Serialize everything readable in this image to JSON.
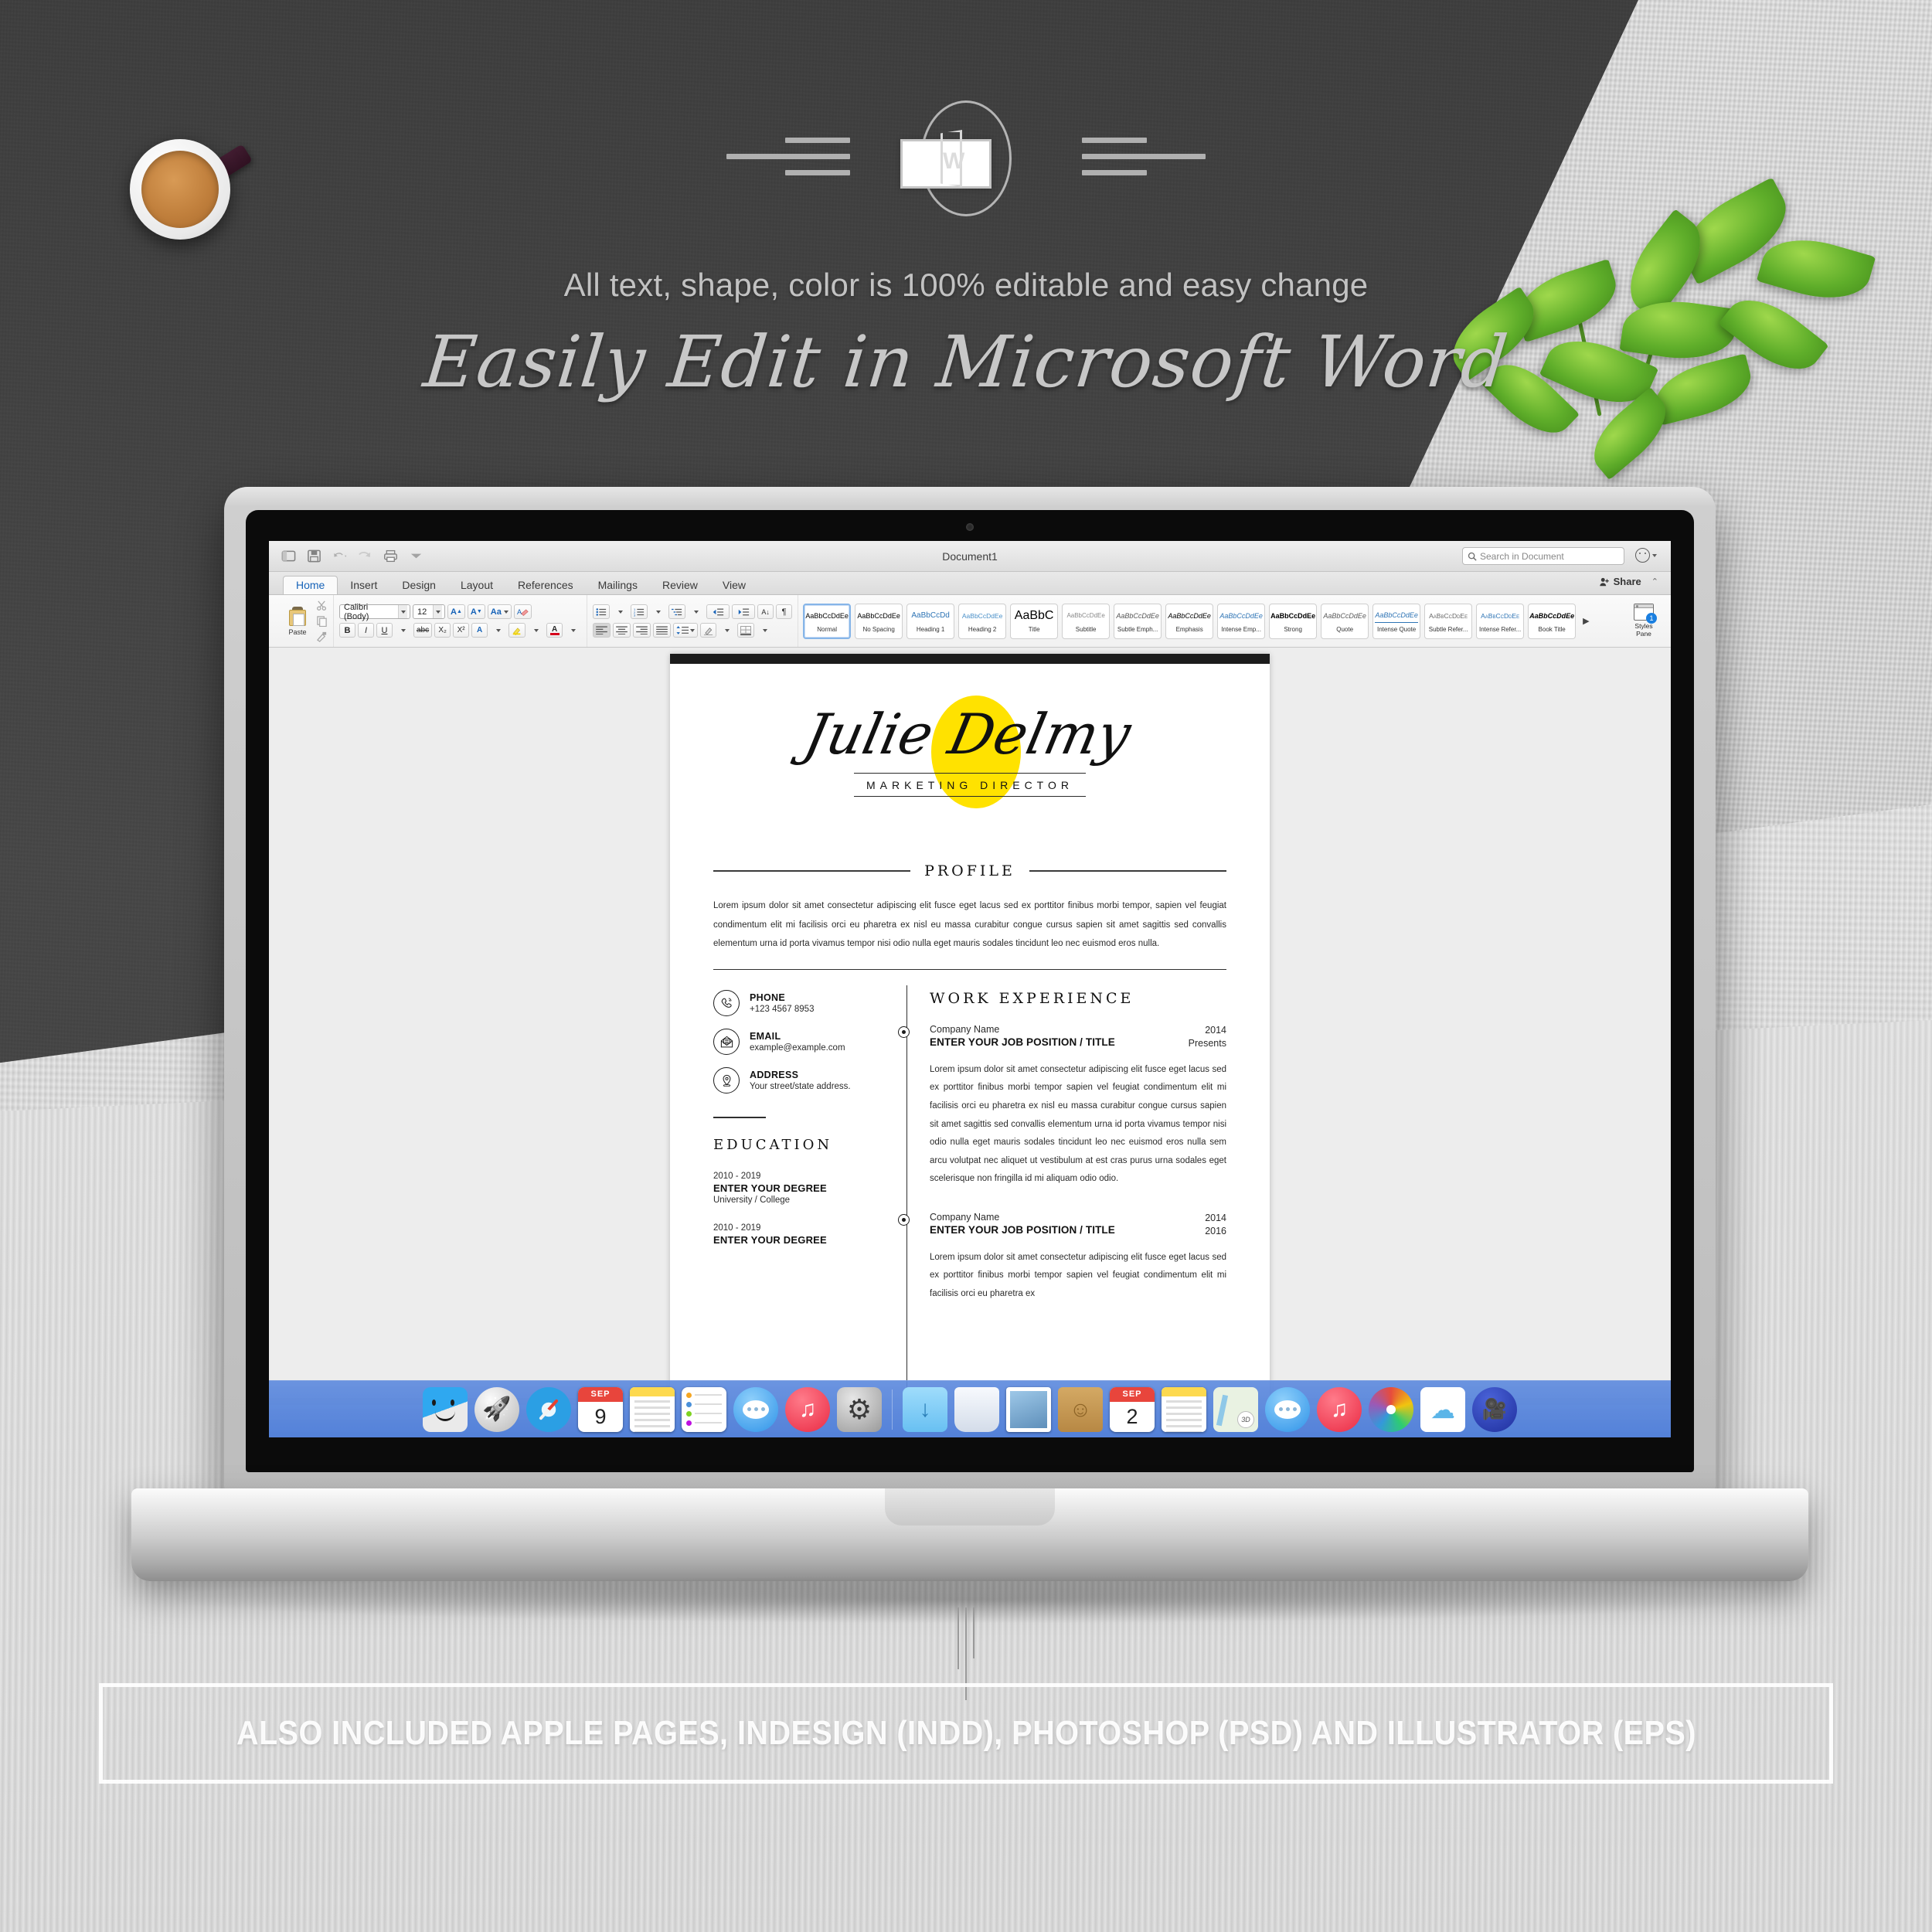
{
  "promo": {
    "word_icon_letter": "W",
    "subheadline": "All text, shape, color is 100% editable and easy change",
    "headline": "Easily Edit in Microsoft Word",
    "bottom_banner": "ALSO INCLUDED APPLE PAGES, INDESIGN (INDD), PHOTOSHOP (PSD) AND ILLUSTRATOR (EPS)"
  },
  "word": {
    "title": "Document1",
    "search_placeholder": "Search in Document",
    "share_label": "Share",
    "share_chevron": "⌃",
    "tabs": [
      {
        "label": "Home",
        "active": true
      },
      {
        "label": "Insert",
        "active": false
      },
      {
        "label": "Design",
        "active": false
      },
      {
        "label": "Layout",
        "active": false
      },
      {
        "label": "References",
        "active": false
      },
      {
        "label": "Mailings",
        "active": false
      },
      {
        "label": "Review",
        "active": false
      },
      {
        "label": "View",
        "active": false
      }
    ],
    "quick_access": [
      "sidebar-toggle-icon",
      "save-icon",
      "undo-icon",
      "redo-icon",
      "print-icon",
      "customize-qat-icon"
    ],
    "clipboard": {
      "paste_label": "Paste",
      "cut_icon": "scissors-icon",
      "copy_icon": "copy-icon",
      "format_painter_icon": "paintbrush-icon"
    },
    "font": {
      "family_value": "Calibri (Body)",
      "size_value": "12",
      "grow_label": "A",
      "shrink_label": "A",
      "change_case_label": "Aa",
      "clear_format_label": "A",
      "bold_label": "B",
      "italic_label": "I",
      "underline_label": "U",
      "strikethrough_label": "abc",
      "subscript_label": "X₂",
      "superscript_label": "X²",
      "text_effects_label": "A",
      "highlight_label": "A",
      "font_color_label": "A"
    },
    "paragraph": {
      "bullets_icon": "bulleted-list-icon",
      "numbering_icon": "numbered-list-icon",
      "multilevel_icon": "multilevel-list-icon",
      "decrease_indent_icon": "decrease-indent-icon",
      "increase_indent_icon": "increase-indent-icon",
      "sort_label": "A↓",
      "marks_label": "¶",
      "align_left_icon": "align-left-icon",
      "align_center_icon": "align-center-icon",
      "align_right_icon": "align-right-icon",
      "justify_icon": "justify-icon",
      "line_spacing_icon": "line-spacing-icon",
      "shading_icon": "shading-icon",
      "borders_icon": "borders-icon"
    },
    "styles": [
      {
        "preview": "AaBbCcDdEe",
        "name": "Normal",
        "selected": true
      },
      {
        "preview": "AaBbCcDdEe",
        "name": "No Spacing",
        "selected": false
      },
      {
        "preview": "AaBbCcDd",
        "name": "Heading 1",
        "selected": false
      },
      {
        "preview": "AaBbCcDdEe",
        "name": "Heading 2",
        "selected": false
      },
      {
        "preview": "AaBbC",
        "name": "Title",
        "selected": false
      },
      {
        "preview": "AaBbCcDdEe",
        "name": "Subtitle",
        "selected": false
      },
      {
        "preview": "AaBbCcDdEe",
        "name": "Subtle Emph...",
        "selected": false
      },
      {
        "preview": "AaBbCcDdEe",
        "name": "Emphasis",
        "selected": false
      },
      {
        "preview": "AaBbCcDdEe",
        "name": "Intense Emp...",
        "selected": false
      },
      {
        "preview": "AaBbCcDdEe",
        "name": "Strong",
        "selected": false
      },
      {
        "preview": "AaBbCcDdEe",
        "name": "Quote",
        "selected": false
      },
      {
        "preview": "AaBbCcDdEe",
        "name": "Intense Quote",
        "selected": false
      },
      {
        "preview": "AaBbCcDdEe",
        "name": "Subtle Refer...",
        "selected": false
      },
      {
        "preview": "AaBbCcDdEe",
        "name": "Intense Refer...",
        "selected": false
      },
      {
        "preview": "AaBbCcDdEe",
        "name": "Book Title",
        "selected": false
      }
    ],
    "styles_more": "▶",
    "styles_pane": {
      "label_line1": "Styles",
      "label_line2": "Pane",
      "badge": "1"
    }
  },
  "resume": {
    "name": "Julie Delmy",
    "role": "MARKETING DIRECTOR",
    "accent_color": "#FFE200",
    "profile": {
      "heading": "PROFILE",
      "text": "Lorem ipsum dolor sit amet consectetur adipiscing elit fusce eget lacus sed ex porttitor finibus morbi tempor, sapien vel feugiat condimentum elit mi facilisis orci eu pharetra ex nisl eu massa curabitur congue cursus sapien sit amet sagittis sed convallis elementum urna id porta vivamus tempor nisi odio nulla eget mauris sodales tincidunt leo nec euismod eros nulla."
    },
    "contacts": [
      {
        "icon": "phone-icon",
        "label": "PHONE",
        "value": "+123 4567 8953"
      },
      {
        "icon": "email-icon",
        "label": "EMAIL",
        "value": "example@example.com"
      },
      {
        "icon": "location-pin-icon",
        "label": "ADDRESS",
        "value": "Your street/state address."
      }
    ],
    "education": {
      "heading": "EDUCATION",
      "items": [
        {
          "years": "2010 - 2019",
          "degree": "ENTER YOUR DEGREE",
          "school": "University / College"
        },
        {
          "years": "2010 - 2019",
          "degree": "ENTER YOUR DEGREE",
          "school": ""
        }
      ]
    },
    "work": {
      "heading": "WORK EXPERIENCE",
      "items": [
        {
          "company": "Company Name",
          "title": "ENTER YOUR JOB POSITION / TITLE",
          "date_from": "2014",
          "date_to": "Presents",
          "body": "Lorem ipsum dolor sit amet consectetur adipiscing elit fusce eget lacus sed ex porttitor finibus morbi tempor sapien vel feugiat condimentum elit mi facilisis orci eu pharetra ex nisl eu massa curabitur congue cursus sapien sit amet sagittis sed convallis elementum urna id porta vivamus tempor nisi odio nulla eget mauris sodales tincidunt leo nec euismod eros nulla sem arcu volutpat nec aliquet ut vestibulum at est cras purus urna sodales eget scelerisque non fringilla id mi aliquam odio odio."
        },
        {
          "company": "Company Name",
          "title": "ENTER YOUR JOB POSITION / TITLE",
          "date_from": "2014",
          "date_to": "2016",
          "body": "Lorem ipsum dolor sit amet consectetur adipiscing elit fusce eget lacus sed ex porttitor finibus morbi tempor sapien vel feugiat condimentum elit mi facilisis orci eu pharetra ex"
        }
      ]
    }
  },
  "dock": {
    "items": [
      {
        "icon": "finder-icon",
        "name": "Finder"
      },
      {
        "icon": "launchpad-icon",
        "name": "Launchpad"
      },
      {
        "icon": "safari-icon",
        "name": "Safari"
      },
      {
        "icon": "calendar-icon",
        "name": "Calendar",
        "month": "SEP",
        "day": "9"
      },
      {
        "icon": "notes-icon",
        "name": "Notes"
      },
      {
        "icon": "reminders-icon",
        "name": "Reminders"
      },
      {
        "icon": "messages-icon",
        "name": "Messages"
      },
      {
        "icon": "itunes-icon",
        "name": "iTunes"
      },
      {
        "icon": "system-preferences-icon",
        "name": "System Preferences"
      },
      {
        "icon": "downloads-folder-icon",
        "name": "Downloads"
      },
      {
        "icon": "trash-icon",
        "name": "Trash"
      },
      {
        "icon": "mail-icon",
        "name": "Mail"
      },
      {
        "icon": "contacts-icon",
        "name": "Contacts"
      },
      {
        "icon": "calendar-icon",
        "name": "Calendar",
        "month": "SEP",
        "day": "2"
      },
      {
        "icon": "notes-icon",
        "name": "Notes"
      },
      {
        "icon": "maps-icon",
        "name": "Maps",
        "badge": "3D"
      },
      {
        "icon": "messages-icon",
        "name": "Messages"
      },
      {
        "icon": "itunes-icon",
        "name": "iTunes"
      },
      {
        "icon": "photos-icon",
        "name": "Photos"
      },
      {
        "icon": "icloud-icon",
        "name": "iCloud Drive"
      },
      {
        "icon": "facetime-icon",
        "name": "FaceTime"
      }
    ]
  }
}
